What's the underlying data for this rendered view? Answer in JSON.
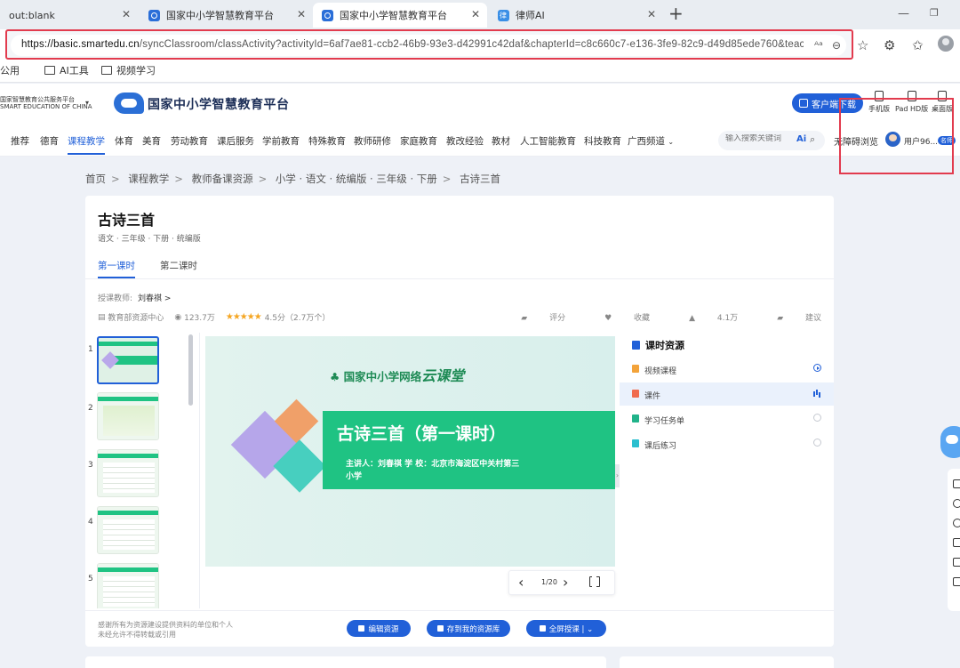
{
  "browser": {
    "tabs": [
      {
        "title": "out:blank",
        "active": false
      },
      {
        "title": "国家中小学智慧教育平台",
        "active": false
      },
      {
        "title": "国家中小学智慧教育平台",
        "active": true
      },
      {
        "title": "律师AI",
        "active": false
      }
    ],
    "url_host": "https://basic.smartedu.cn",
    "url_path": "/syncClassroom/classActivity?activityId=6af7ae81-ccb2-46b9-93e3-d42991c42daf&chapterId=c8c660c7-e136-3fe9-82c9-d49d85ede760&teachingm...",
    "bookmarks": [
      "公用",
      "AI工具",
      "视频学习"
    ]
  },
  "site": {
    "org_name_cn": "国家智慧教育公共服务平台",
    "org_name_en": "SMART EDUCATION OF CHINA",
    "logo_text": "国家中小学智慧教育平台",
    "client_button": "客户端下载",
    "devices": [
      "手机版",
      "Pad HD版",
      "桌面版"
    ],
    "nav": [
      "推荐",
      "德育",
      "课程教学",
      "体育",
      "美育",
      "劳动教育",
      "课后服务",
      "学前教育",
      "特殊教育",
      "教师研修",
      "家庭教育",
      "教改经验",
      "教材",
      "人工智能教育",
      "科技教育",
      "广西频道"
    ],
    "nav_active": "课程教学",
    "search_placeholder": "输入搜索关键词",
    "search_ai": "Ai",
    "accessible_browse": "无障碍浏览",
    "user_name": "用户96...",
    "user_badge": "名师"
  },
  "breadcrumb": [
    "首页",
    "课程教学",
    "教师备课资源",
    "小学 · 语文 · 统编版 · 三年级 · 下册",
    "古诗三首"
  ],
  "lesson": {
    "title": "古诗三首",
    "subtitle": "语文 · 三年级 · 下册 · 统编版",
    "tabs": [
      "第一课时",
      "第二课时"
    ],
    "teacher_label": "授课教师:",
    "teacher_name": "刘春祺 >",
    "source": "教育部资源中心",
    "views": "123.7万",
    "stars": "★★★★★",
    "rating": "4.5分（2.7万个）",
    "actions": [
      "评分",
      "收藏",
      "4.1万",
      "建议"
    ]
  },
  "thumbnails": {
    "numbers": [
      "1",
      "2",
      "3",
      "4",
      "5"
    ],
    "selected_index": 0
  },
  "slide": {
    "brand": "国家中小学网络",
    "brand_calligraphy": "云课堂",
    "title": "古诗三首（第一课时）",
    "info_line1": "主讲人：刘春祺          学    校：北京市海淀区中关村第三",
    "info_line2": "小学",
    "page": "1/20",
    "page_progress": 0.05
  },
  "resources": {
    "title": "课时资源",
    "items": [
      {
        "label": "视频课程",
        "icon_color": "#f3a33a",
        "status": "play"
      },
      {
        "label": "课件",
        "icon_color": "#f06b4e",
        "status": "bars",
        "active": true
      },
      {
        "label": "学习任务单",
        "icon_color": "#21b38a",
        "status": "empty"
      },
      {
        "label": "课后练习",
        "icon_color": "#2bbfcf",
        "status": "empty"
      }
    ]
  },
  "footer": {
    "note_line1": "感谢所有为资源建设提供资料的单位和个人",
    "note_line2": "未经允许不得转载或引用",
    "buttons": [
      "编辑资源",
      "存到我的资源库",
      "全屏授课 | ⌄"
    ]
  },
  "colors": {
    "brand_blue": "#2160d8",
    "highlight_red": "#e23b4e",
    "slide_green": "#1fc383"
  }
}
